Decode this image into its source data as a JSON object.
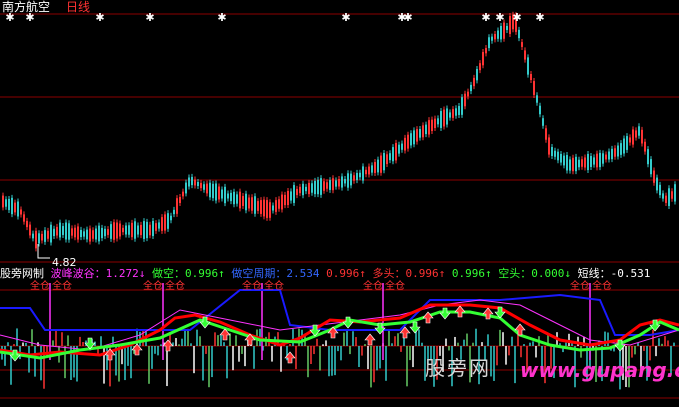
{
  "header": {
    "stock_name": "南方航空",
    "period": "日线"
  },
  "main_chart": {
    "low_label": "4.82",
    "star_markers_count": 12
  },
  "indicator": {
    "name": "股旁网制",
    "fields": [
      {
        "label": "波峰波谷",
        "value": "1.272",
        "arrow": "↓",
        "label_color": "#ff33ff",
        "value_color": "#ff33ff"
      },
      {
        "label": "做空",
        "value": "0.996",
        "arrow": "↑",
        "label_color": "#33ff33",
        "value_color": "#33ff33"
      },
      {
        "label": "做空周期",
        "value": "2.534",
        "arrow": "",
        "label_color": "#3366ff",
        "value_color": "#3366ff"
      },
      {
        "label": "",
        "value": "0.996",
        "arrow": "↑",
        "label_color": "#ff3333",
        "value_color": "#ff3333"
      },
      {
        "label": "多头",
        "value": "0.996",
        "arrow": "↑",
        "label_color": "#ff3333",
        "value_color": "#ff3333"
      },
      {
        "label": "",
        "value": "0.996",
        "arrow": "↑",
        "label_color": "#33ff33",
        "value_color": "#33ff33"
      },
      {
        "label": "空头",
        "value": "0.000",
        "arrow": "↓",
        "label_color": "#33ff33",
        "value_color": "#33ff33"
      },
      {
        "label": "短线",
        "value": "-0.531",
        "arrow": "",
        "label_color": "#ffffff",
        "value_color": "#ffffff"
      }
    ],
    "signal_label": "全仓"
  },
  "watermark": {
    "cn": "股旁网",
    "url": "www.gupang.com"
  },
  "colors": {
    "up": "#ff3333",
    "down": "#33cccc",
    "grid": "#8b0000",
    "magenta": "#ff33ff",
    "blue": "#1a1aff",
    "green": "#33ff33",
    "red": "#ff0000"
  }
}
